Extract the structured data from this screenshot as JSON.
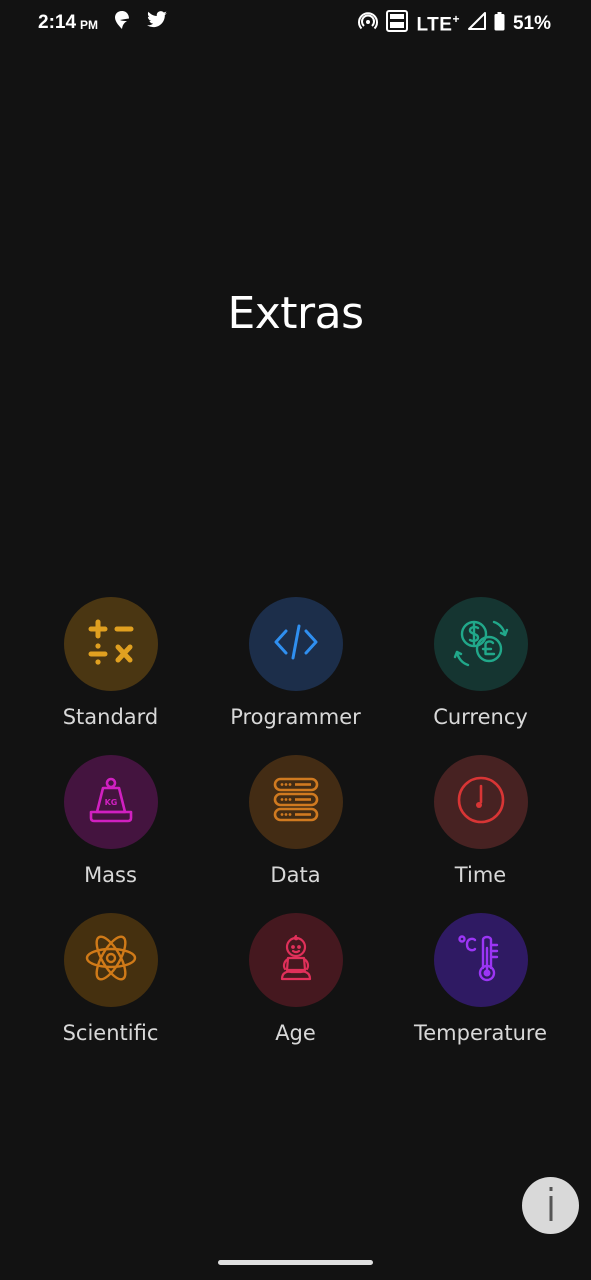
{
  "status_bar": {
    "time": "2:14",
    "time_suffix": "PM",
    "network": "LTE",
    "network_plus": "+",
    "battery": "51%",
    "icons": [
      "swiggy-icon",
      "twitter-icon",
      "hotspot-icon",
      "volte-icon",
      "signal-icon",
      "battery-icon"
    ]
  },
  "title": "Extras",
  "tiles": [
    {
      "label": "Standard",
      "icon": "calculator-operators-icon",
      "bg": "#4a3612",
      "fg": "#e0a020"
    },
    {
      "label": "Programmer",
      "icon": "code-icon",
      "bg": "#1c2e4a",
      "fg": "#2f8ff0"
    },
    {
      "label": "Currency",
      "icon": "currency-exchange-icon",
      "bg": "#153531",
      "fg": "#21a88a"
    },
    {
      "label": "Mass",
      "icon": "weight-icon",
      "bg": "#44143f",
      "fg": "#d020c0"
    },
    {
      "label": "Data",
      "icon": "server-icon",
      "bg": "#432c14",
      "fg": "#d07a20"
    },
    {
      "label": "Time",
      "icon": "clock-icon",
      "bg": "#472222",
      "fg": "#d83535"
    },
    {
      "label": "Scientific",
      "icon": "atom-icon",
      "bg": "#45300f",
      "fg": "#d07a18"
    },
    {
      "label": "Age",
      "icon": "baby-icon",
      "bg": "#45181f",
      "fg": "#e0305a"
    },
    {
      "label": "Temperature",
      "icon": "thermometer-icon",
      "bg": "#2f1a63",
      "fg": "#9b35f5"
    }
  ],
  "info_button": {
    "icon": "info-icon"
  }
}
